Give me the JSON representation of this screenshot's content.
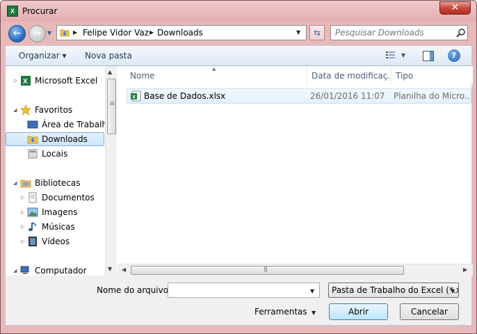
{
  "window": {
    "title": "Procurar",
    "app_icon_glyph": "X",
    "close_glyph": "✕"
  },
  "nav": {
    "back_glyph": "←",
    "forward_glyph": "→",
    "breadcrumbs": [
      "Felipe Vidor Vaz",
      "Downloads"
    ],
    "search_placeholder": "Pesquisar Downloads"
  },
  "toolbar": {
    "organize_label": "Organizar ▾",
    "new_folder_label": "Nova pasta",
    "help_glyph": "?"
  },
  "sidebar": {
    "items": [
      {
        "label": "Microsoft Excel",
        "icon": "excel-icon"
      },
      {
        "label": "Favoritos",
        "icon": "star-icon"
      },
      {
        "label": "Área de Trabalho",
        "icon": "desktop-icon"
      },
      {
        "label": "Downloads",
        "icon": "downloads-folder-icon"
      },
      {
        "label": "Locais",
        "icon": "places-icon"
      },
      {
        "label": "Bibliotecas",
        "icon": "libraries-icon"
      },
      {
        "label": "Documentos",
        "icon": "documents-icon"
      },
      {
        "label": "Imagens",
        "icon": "pictures-icon"
      },
      {
        "label": "Músicas",
        "icon": "music-icon"
      },
      {
        "label": "Vídeos",
        "icon": "videos-icon"
      },
      {
        "label": "Computador",
        "icon": "computer-icon"
      }
    ]
  },
  "file_list": {
    "columns": [
      "Nome",
      "Data de modificaç...",
      "Tipo"
    ],
    "rows": [
      {
        "name": "Base de Dados.xlsx",
        "date": "26/01/2016 11:07",
        "type": "Planilha do Micro..."
      }
    ]
  },
  "bottom": {
    "filename_label": "Nome do arquivo:",
    "filename_value": "",
    "filetype_value": "Pasta de Trabalho do Excel (*.xl",
    "tools_label": "Ferramentas",
    "open_label": "Abrir",
    "cancel_label": "Cancelar"
  },
  "colors": {
    "frame": "#e8b9ba",
    "selection": "#cde4fa",
    "excel_green": "#1d7a3f",
    "link_text": "#1e395b"
  }
}
